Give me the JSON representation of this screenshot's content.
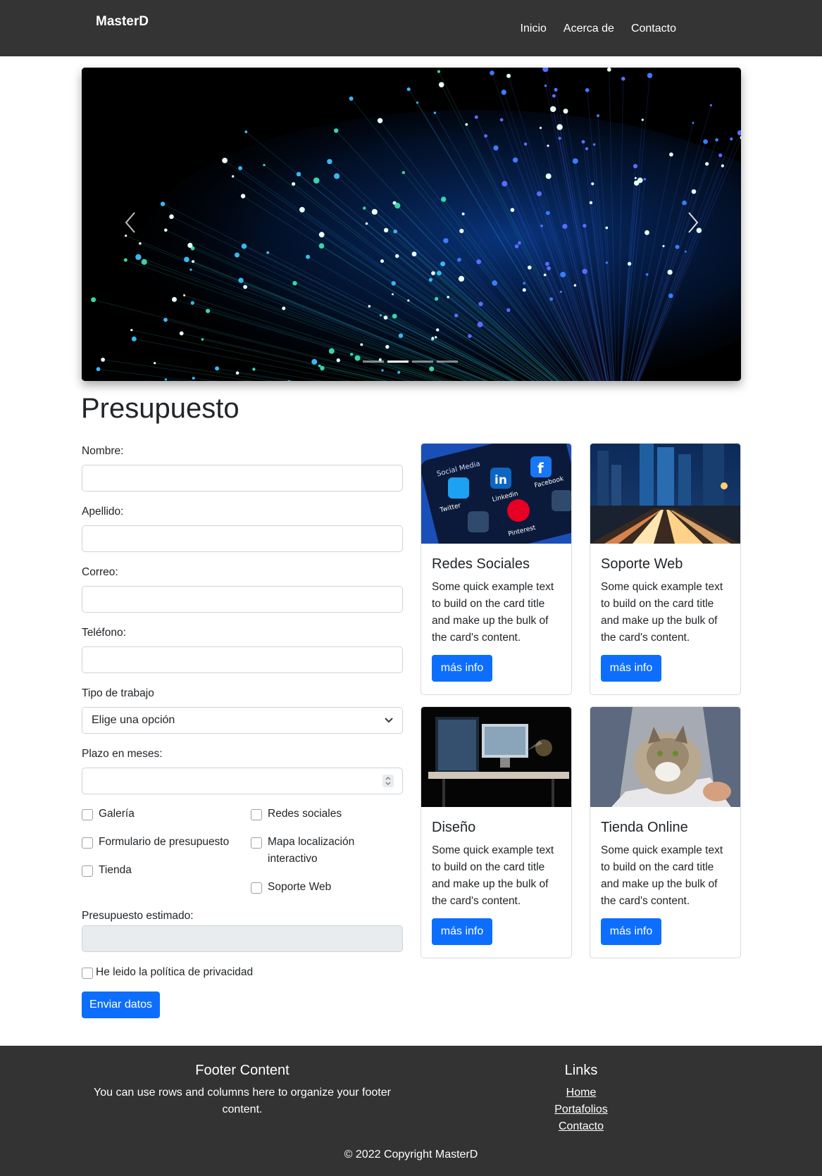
{
  "navbar": {
    "brand": "MasterD",
    "links": [
      "Inicio",
      "Acerca de",
      "Contacto"
    ]
  },
  "carousel": {
    "slide_count": 4,
    "active_index": 1,
    "image": "fiber-optic-lights"
  },
  "page_title": "Presupuesto",
  "form": {
    "nombre_label": "Nombre:",
    "apellido_label": "Apellido:",
    "correo_label": "Correo:",
    "telefono_label": "Teléfono:",
    "tipo_label": "Tipo de trabajo",
    "tipo_selected": "Elige una opción",
    "plazo_label": "Plazo en meses:",
    "checkboxes_left": [
      "Galería",
      "Formulario de presupuesto",
      "Tienda"
    ],
    "checkboxes_right": [
      "Redes sociales",
      "Mapa localización interactivo",
      "Soporte Web"
    ],
    "presupuesto_label": "Presupuesto estimado:",
    "privacy_label": "He leido la política de privacidad",
    "submit_label": "Enviar datos"
  },
  "cards": [
    {
      "title": "Redes Sociales",
      "text": "Some quick example text to build on the card title and make up the bulk of the card's content.",
      "button": "más info",
      "image": "social-media-icons"
    },
    {
      "title": "Soporte Web",
      "text": "Some quick example text to build on the card title and make up the bulk of the card's content.",
      "button": "más info",
      "image": "city-night-traffic"
    },
    {
      "title": "Diseño",
      "text": "Some quick example text to build on the card title and make up the bulk of the card's content.",
      "button": "más info",
      "image": "dark-desk-monitors"
    },
    {
      "title": "Tienda Online",
      "text": "Some quick example text to build on the card title and make up the bulk of the card's content.",
      "button": "más info",
      "image": "cat-in-arms"
    }
  ],
  "footer": {
    "content_title": "Footer Content",
    "content_text": "You can use rows and columns here to organize your footer content.",
    "links_title": "Links",
    "links": [
      "Home",
      "Portafolios",
      "Contacto"
    ],
    "copyright": "© 2022 Copyright MasterD"
  },
  "colors": {
    "navbar_bg": "#343434",
    "footer_bg": "#333333",
    "primary": "#0d6efd"
  }
}
